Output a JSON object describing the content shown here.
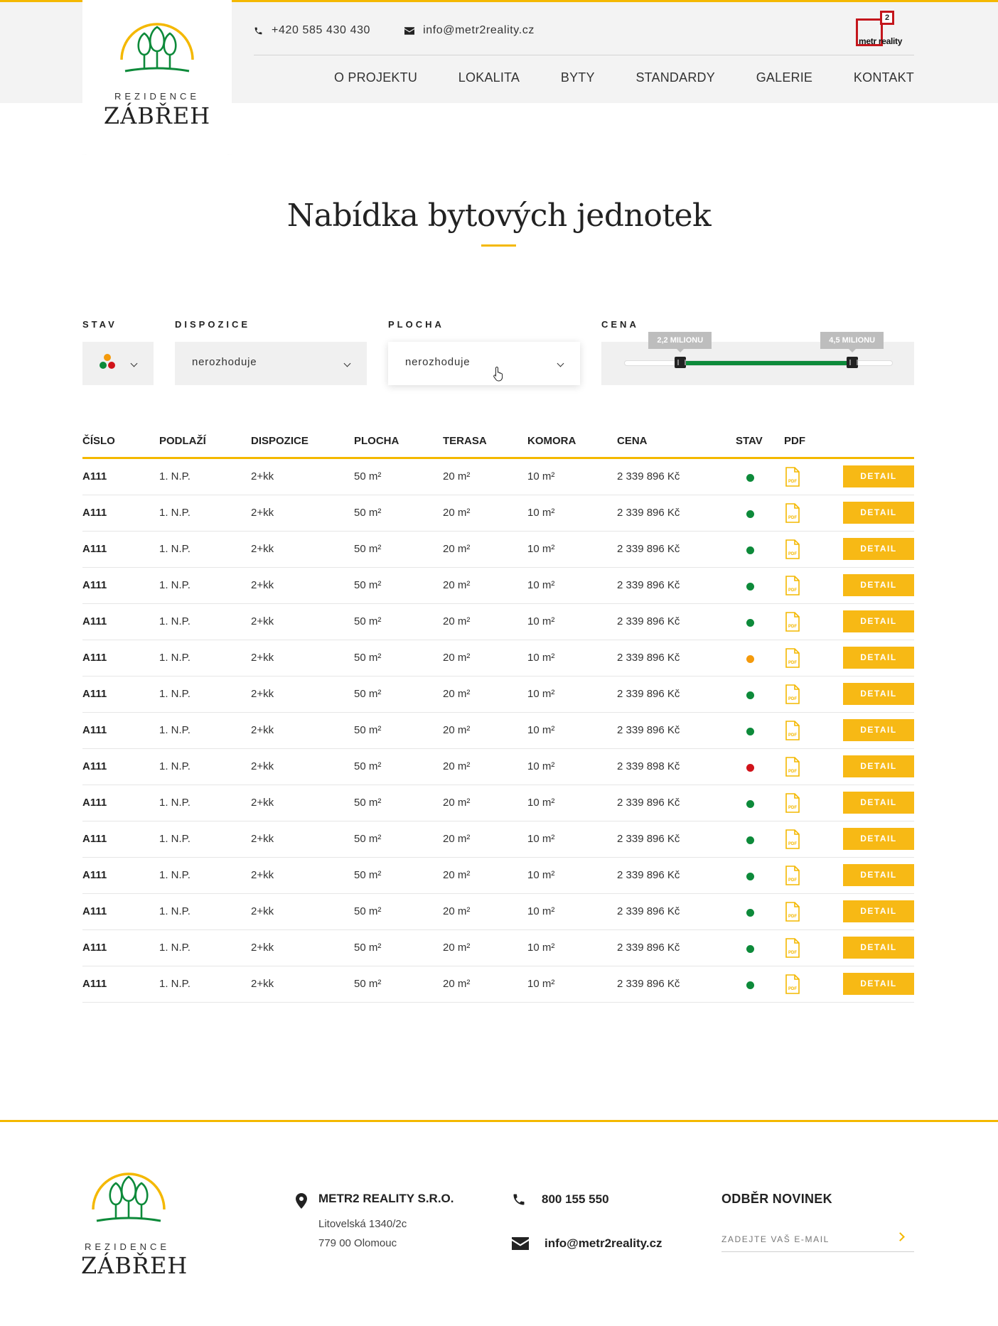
{
  "header": {
    "phone": "+420 585 430 430",
    "email": "info@metr2reality.cz",
    "brand": {
      "word": "metr",
      "superscript": "2",
      "word2": "reality"
    },
    "nav": [
      "O PROJEKTU",
      "LOKALITA",
      "BYTY",
      "STANDARDY",
      "GALERIE",
      "KONTAKT"
    ]
  },
  "logo": {
    "sub": "REZIDENCE",
    "main": "ZÁBŘEH"
  },
  "page": {
    "title": "Nabídka bytových jednotek"
  },
  "filters": {
    "stav": {
      "label": "STAV",
      "dot_colors": [
        "#f49a0c",
        "#0d8a3a",
        "#d0131a"
      ]
    },
    "dispozice": {
      "label": "DISPOZICE",
      "value": "nerozhoduje"
    },
    "plocha": {
      "label": "PLOCHA",
      "value": "nerozhoduje"
    },
    "cena": {
      "label": "CENA",
      "min_label": "2,2 MILIONU",
      "max_label": "4,5 MILIONU",
      "min_fraction": 0.21,
      "max_fraction": 0.85
    }
  },
  "table": {
    "headers": [
      "ČÍSLO",
      "PODLAŽÍ",
      "DISPOZICE",
      "PLOCHA",
      "TERASA",
      "KOMORA",
      "CENA",
      "STAV",
      "PDF"
    ],
    "detail_label": "DETAIL",
    "pdf_label": "PDF",
    "status_colors": {
      "available": "#0d8a3a",
      "reserved": "#f49a0c",
      "sold": "#d0131a"
    },
    "rows": [
      {
        "code": "A111",
        "floor": "1. N.P.",
        "layout": "2+kk",
        "area": "50 m²",
        "terrace": "20 m²",
        "storage": "10 m²",
        "price": "2 339 896 Kč",
        "status": "available"
      },
      {
        "code": "A111",
        "floor": "1. N.P.",
        "layout": "2+kk",
        "area": "50 m²",
        "terrace": "20 m²",
        "storage": "10 m²",
        "price": "2 339 896 Kč",
        "status": "available"
      },
      {
        "code": "A111",
        "floor": "1. N.P.",
        "layout": "2+kk",
        "area": "50 m²",
        "terrace": "20 m²",
        "storage": "10 m²",
        "price": "2 339 896 Kč",
        "status": "available"
      },
      {
        "code": "A111",
        "floor": "1. N.P.",
        "layout": "2+kk",
        "area": "50 m²",
        "terrace": "20 m²",
        "storage": "10 m²",
        "price": "2 339 896 Kč",
        "status": "available"
      },
      {
        "code": "A111",
        "floor": "1. N.P.",
        "layout": "2+kk",
        "area": "50 m²",
        "terrace": "20 m²",
        "storage": "10 m²",
        "price": "2 339 896 Kč",
        "status": "available"
      },
      {
        "code": "A111",
        "floor": "1. N.P.",
        "layout": "2+kk",
        "area": "50 m²",
        "terrace": "20 m²",
        "storage": "10 m²",
        "price": "2 339 896 Kč",
        "status": "reserved"
      },
      {
        "code": "A111",
        "floor": "1. N.P.",
        "layout": "2+kk",
        "area": "50 m²",
        "terrace": "20 m²",
        "storage": "10 m²",
        "price": "2 339 896 Kč",
        "status": "available"
      },
      {
        "code": "A111",
        "floor": "1. N.P.",
        "layout": "2+kk",
        "area": "50 m²",
        "terrace": "20 m²",
        "storage": "10 m²",
        "price": "2 339 896 Kč",
        "status": "available"
      },
      {
        "code": "A111",
        "floor": "1. N.P.",
        "layout": "2+kk",
        "area": "50 m²",
        "terrace": "20 m²",
        "storage": "10 m²",
        "price": "2 339 898 Kč",
        "status": "sold"
      },
      {
        "code": "A111",
        "floor": "1. N.P.",
        "layout": "2+kk",
        "area": "50 m²",
        "terrace": "20 m²",
        "storage": "10 m²",
        "price": "2 339 896 Kč",
        "status": "available"
      },
      {
        "code": "A111",
        "floor": "1. N.P.",
        "layout": "2+kk",
        "area": "50 m²",
        "terrace": "20 m²",
        "storage": "10 m²",
        "price": "2 339 896 Kč",
        "status": "available"
      },
      {
        "code": "A111",
        "floor": "1. N.P.",
        "layout": "2+kk",
        "area": "50 m²",
        "terrace": "20 m²",
        "storage": "10 m²",
        "price": "2 339 896 Kč",
        "status": "available"
      },
      {
        "code": "A111",
        "floor": "1. N.P.",
        "layout": "2+kk",
        "area": "50 m²",
        "terrace": "20 m²",
        "storage": "10 m²",
        "price": "2 339 896 Kč",
        "status": "available"
      },
      {
        "code": "A111",
        "floor": "1. N.P.",
        "layout": "2+kk",
        "area": "50 m²",
        "terrace": "20 m²",
        "storage": "10 m²",
        "price": "2 339 896 Kč",
        "status": "available"
      },
      {
        "code": "A111",
        "floor": "1. N.P.",
        "layout": "2+kk",
        "area": "50 m²",
        "terrace": "20 m²",
        "storage": "10 m²",
        "price": "2 339 896 Kč",
        "status": "available"
      }
    ]
  },
  "footer": {
    "company": "METR2 REALITY S.R.O.",
    "address_line1": "Litovelská 1340/2c",
    "address_line2": "779 00 Olomouc",
    "phone": "800 155 550",
    "email": "info@metr2reality.cz",
    "newsletter_title": "ODBĚR NOVINEK",
    "newsletter_placeholder": "ZADEJTE VAŠ E-MAIL"
  },
  "colors": {
    "accent": "#f4b800",
    "green": "#0d8a3a"
  }
}
